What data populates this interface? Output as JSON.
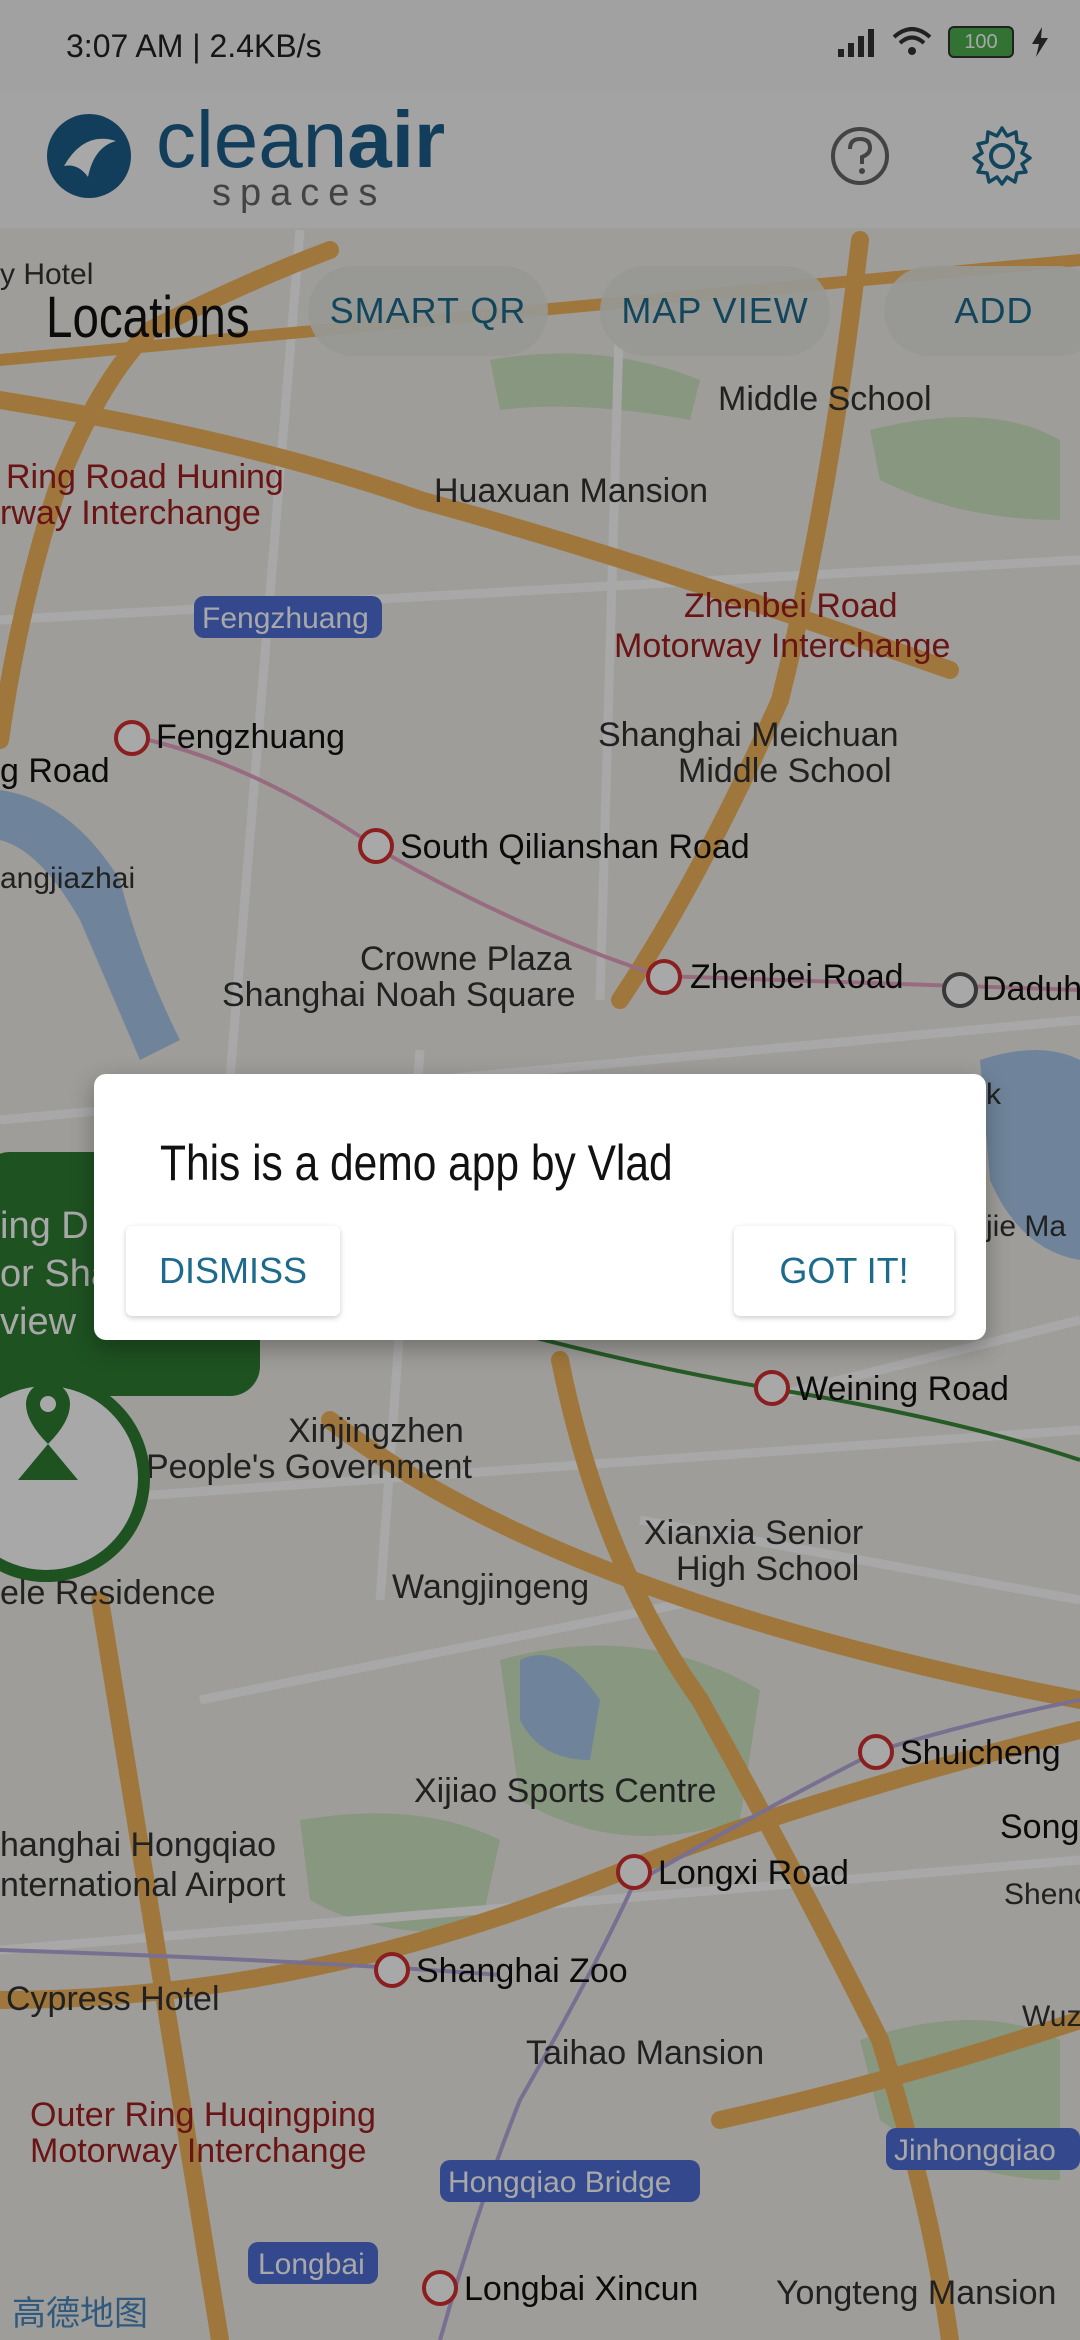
{
  "status_bar": {
    "time": "3:07 AM | 2.4KB/s",
    "battery": "100"
  },
  "app_bar": {
    "logo_clean": "clean",
    "logo_air": "air",
    "logo_spaces": "spaces"
  },
  "toolbar": {
    "title": "Locations",
    "tabs": [
      "SMART QR",
      "MAP VIEW",
      "ADD"
    ]
  },
  "map": {
    "watermark": "高德地图",
    "labels": [
      {
        "text": "Ring Road Huning",
        "style": "place"
      },
      {
        "text": "rway Interchange",
        "style": "place"
      },
      {
        "text": "Huaxuan Mansion",
        "style": "place"
      },
      {
        "text": "Fengzhuang",
        "style": "district"
      },
      {
        "text": "Zhenbei Road",
        "style": "red"
      },
      {
        "text": "Motorway Interchange",
        "style": "red"
      },
      {
        "text": "Fengzhuang",
        "style": "station"
      },
      {
        "text": "g Road",
        "style": "place"
      },
      {
        "text": "Shanghai Meichuan",
        "style": "place"
      },
      {
        "text": "Middle School",
        "style": "place"
      },
      {
        "text": "South Qilianshan Road",
        "style": "station"
      },
      {
        "text": "angjiazhai",
        "style": "place"
      },
      {
        "text": "Crowne Plaza",
        "style": "place"
      },
      {
        "text": "Shanghai Noah Square",
        "style": "place"
      },
      {
        "text": "Zhenbei Road",
        "style": "station"
      },
      {
        "text": "Daduh",
        "style": "station"
      },
      {
        "text": "Middle School",
        "style": "place"
      },
      {
        "text": "y Hotel",
        "style": "place"
      },
      {
        "text": "Weining Road",
        "style": "station"
      },
      {
        "text": "Xinjingzhen",
        "style": "place"
      },
      {
        "text": "People's Government",
        "style": "place"
      },
      {
        "text": "Xianxia Senior",
        "style": "place"
      },
      {
        "text": "High School",
        "style": "place"
      },
      {
        "text": "Wangjingeng",
        "style": "place"
      },
      {
        "text": "ele Residence",
        "style": "place"
      },
      {
        "text": "Shuicheng",
        "style": "station"
      },
      {
        "text": "Xijiao Sports Centre",
        "style": "place"
      },
      {
        "text": "Song",
        "style": "station"
      },
      {
        "text": "hanghai Hongqiao",
        "style": "place"
      },
      {
        "text": "nternational Airport",
        "style": "place"
      },
      {
        "text": "Longxi Road",
        "style": "station"
      },
      {
        "text": "Shenc",
        "style": "place"
      },
      {
        "text": "Cypress Hotel",
        "style": "place"
      },
      {
        "text": "Shanghai Zoo",
        "style": "station"
      },
      {
        "text": "Wuz",
        "style": "place"
      },
      {
        "text": "Taihao Mansion",
        "style": "place"
      },
      {
        "text": "Outer Ring Huqingping",
        "style": "red"
      },
      {
        "text": "Motorway Interchange",
        "style": "red"
      },
      {
        "text": "Jinhongqiao",
        "style": "district"
      },
      {
        "text": "Hongqiao Bridge",
        "style": "district"
      },
      {
        "text": "Longbai",
        "style": "district"
      },
      {
        "text": "Longbai Xincun",
        "style": "station"
      },
      {
        "text": "Yongteng Mansion",
        "style": "place"
      },
      {
        "text": "jie Ma",
        "style": "place"
      },
      {
        "text": "k",
        "style": "place"
      }
    ],
    "callout_lines": [
      "ing D",
      "or Sha",
      " view"
    ]
  },
  "dialog": {
    "message": "This is a demo app by Vlad",
    "dismiss": "DISMISS",
    "confirm": "GOT IT!"
  },
  "colors": {
    "brand": "#1d5f8a",
    "accent": "#1d6b8c",
    "callout_green": "#2e7d32"
  }
}
